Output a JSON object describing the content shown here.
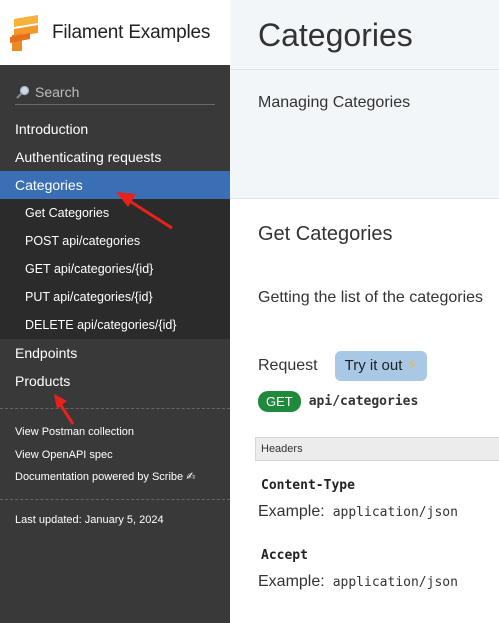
{
  "sidebar": {
    "brand": "Filament Examples",
    "search_placeholder": "Search",
    "nav": {
      "introduction": "Introduction",
      "authenticating": "Authenticating requests",
      "categories": "Categories",
      "sub_items": [
        "Get Categories",
        "POST api/categories",
        "GET api/categories/{id}",
        "PUT api/categories/{id}",
        "DELETE api/categories/{id}"
      ],
      "endpoints": "Endpoints",
      "products": "Products"
    },
    "links": {
      "postman": "View Postman collection",
      "openapi": "View OpenAPI spec",
      "scribe": "Documentation powered by Scribe ✍"
    },
    "last_updated": "Last updated: January 5, 2024"
  },
  "main": {
    "title": "Categories",
    "intro": "Managing Categories",
    "section_title": "Get Categories",
    "section_desc": "Getting the list of the categories",
    "request_label": "Request",
    "try_button": "Try it out",
    "try_icon": "⚡",
    "method": "GET",
    "path": "api/categories",
    "headers_label": "Headers",
    "headers": [
      {
        "name": "Content-Type",
        "example_label": "Example:",
        "value": "application/json"
      },
      {
        "name": "Accept",
        "example_label": "Example:",
        "value": "application/json"
      }
    ]
  },
  "colors": {
    "sidebar_bg": "#393939",
    "active_bg": "#3a6fb5",
    "get_badge": "#1f8a3b",
    "try_button": "#a9c8e6",
    "annotation_arrow": "#e8221b"
  }
}
